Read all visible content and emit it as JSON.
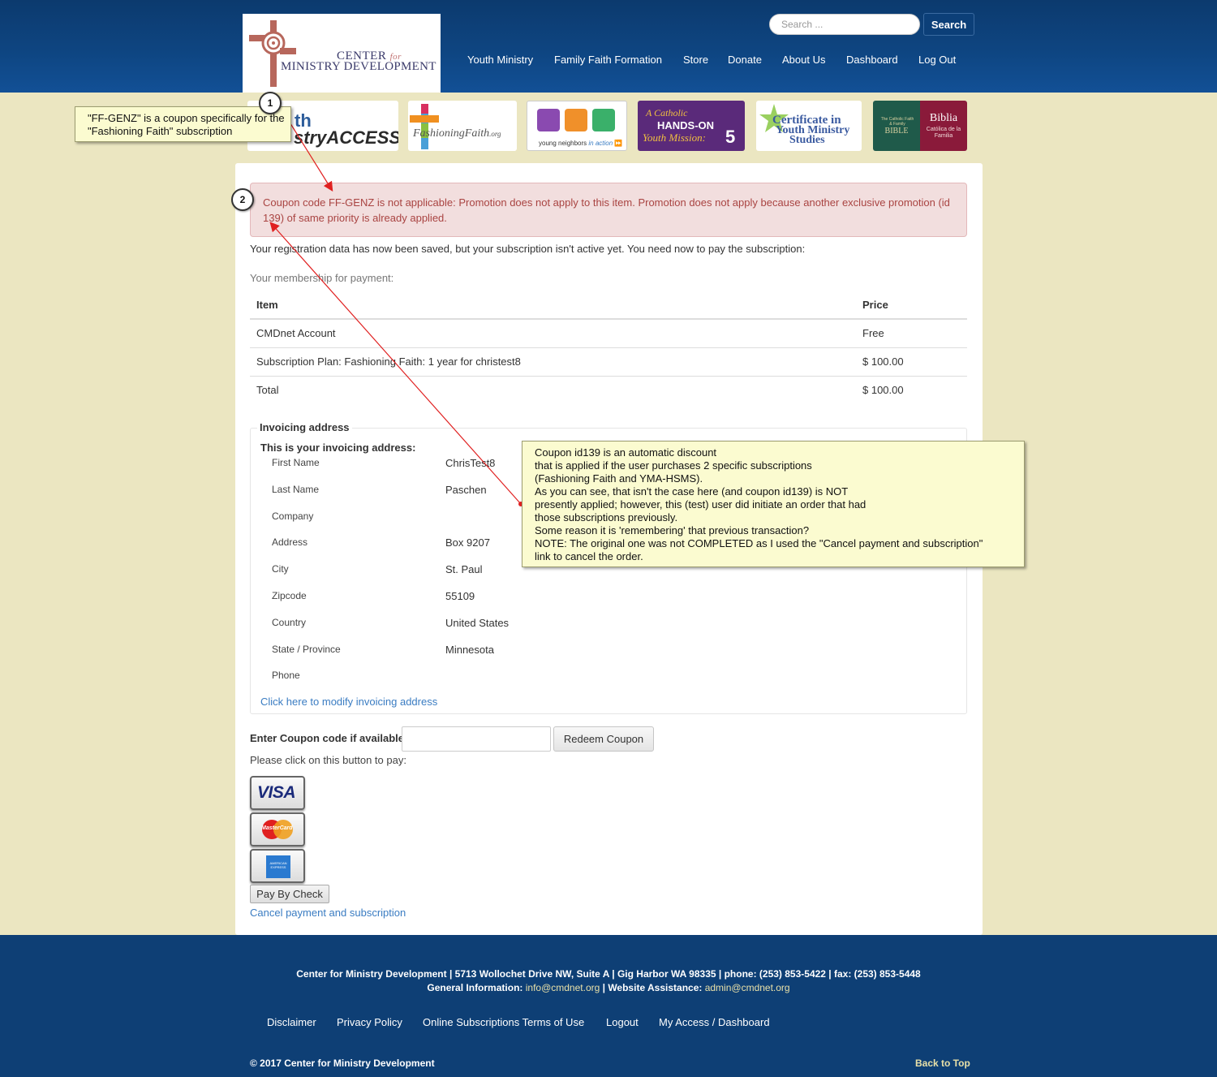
{
  "header": {
    "logo_line1": "CENTER",
    "logo_for": "for",
    "logo_line2": "MINISTRY DEVELOPMENT",
    "search_placeholder": "Search ...",
    "search_button": "Search",
    "nav": [
      "Youth Ministry",
      "Family Faith Formation",
      "Store",
      "Donate",
      "About Us",
      "Dashboard",
      "Log Out"
    ]
  },
  "banners": {
    "access_text": "stryACCESS",
    "access_th": "th",
    "fashioning_text": "FashioningFaith",
    "fashioning_org": ".org",
    "young_neighbors_pre": "young neighbors ",
    "young_neighbors_in": "in action",
    "hands_on_a": "A Catholic",
    "hands_on_title": "HANDS-ON",
    "hands_on_mission": "Youth Mission:",
    "hands_on_num": "5",
    "certificate_line1": "Certificate in",
    "certificate_line2": "Youth Ministry",
    "certificate_line3": "Studies",
    "bible_left": "BIBLE",
    "bible_left_small": "The Catholic Faith & Family",
    "bible_right": "Biblia",
    "bible_right_small": "Católica de la Familia"
  },
  "alert": {
    "text": "Coupon code FF-GENZ is not applicable: Promotion does not apply to this item. Promotion does not apply because another exclusive promotion (id 139) of same priority is already applied."
  },
  "registration_note": "Your registration data has now been saved, but your subscription isn't active yet. You need now to pay the subscription:",
  "membership_label": "Your membership for payment:",
  "items_table": {
    "headers": [
      "Item",
      "Price"
    ],
    "rows": [
      {
        "item": "CMDnet Account",
        "price": "Free"
      },
      {
        "item": "Subscription Plan: Fashioning Faith: 1 year for christest8",
        "price": "$ 100.00"
      },
      {
        "item": "Total",
        "price": "$ 100.00"
      }
    ]
  },
  "invoicing": {
    "legend": "Invoicing address",
    "heading": "This is your invoicing address:",
    "fields": [
      {
        "label": "First Name",
        "value": "ChrisTest8"
      },
      {
        "label": "Last Name",
        "value": "Paschen"
      },
      {
        "label": "Company",
        "value": ""
      },
      {
        "label": "Address",
        "value": "Box 9207"
      },
      {
        "label": "City",
        "value": "St. Paul"
      },
      {
        "label": "Zipcode",
        "value": "55109"
      },
      {
        "label": "Country",
        "value": "United States"
      },
      {
        "label": "State / Province",
        "value": "Minnesota"
      },
      {
        "label": "Phone",
        "value": ""
      }
    ],
    "modify_link": "Click here to modify invoicing address"
  },
  "coupon": {
    "label": "Enter Coupon code if available:",
    "value": "",
    "button": "Redeem Coupon"
  },
  "payment": {
    "prompt": "Please click on this button to pay:",
    "visa": "VISA",
    "mastercard": "MasterCard",
    "amex": "AMERICAN EXPRESS",
    "check_button": "Pay By Check",
    "cancel_link": "Cancel payment and subscription"
  },
  "annotations": {
    "note1": "\"FF-GENZ\" is a coupon specifically for the \"Fashioning Faith\" subscription",
    "badge1": "1",
    "badge2": "2",
    "note2_lines": [
      "Coupon id139 is an automatic discount",
      "that is applied if the user purchases 2 specific subscriptions",
      "(Fashioning Faith and YMA-HSMS).",
      "As you can see, that isn't the case here (and coupon id139) is NOT",
      "presently applied; however, this (test) user did initiate an order that had",
      "those subscriptions previously.",
      "Some reason it is 'remembering' that previous transaction?",
      "NOTE: The original one was not COMPLETED as I used the \"Cancel payment and subscription\"",
      "link to cancel the order."
    ]
  },
  "footer": {
    "address_line": "Center for Ministry Development | 5713 Wollochet Drive NW, Suite A | Gig Harbor WA 98335 | phone: (253) 853-5422 | fax: (253) 853-5448",
    "info_prefix": "General Information: ",
    "info_email": "info@cmdnet.org",
    "assist_prefix": " | Website Assistance: ",
    "assist_email": "admin@cmdnet.org",
    "links": [
      "Disclaimer",
      "Privacy Policy",
      "Online Subscriptions Terms of Use",
      "Logout",
      "My Access / Dashboard"
    ],
    "copyright": "© 2017 Center for Ministry Development",
    "back_to_top": "Back to Top"
  },
  "colors": {
    "header_blue": "#0e4581",
    "page_bg": "#ebe6c1",
    "alert_bg": "#f2dede",
    "alert_text": "#a94442",
    "link_blue": "#3a7cc2",
    "annotation_bg": "#fbfbd0",
    "arrow_red": "#e02020"
  }
}
